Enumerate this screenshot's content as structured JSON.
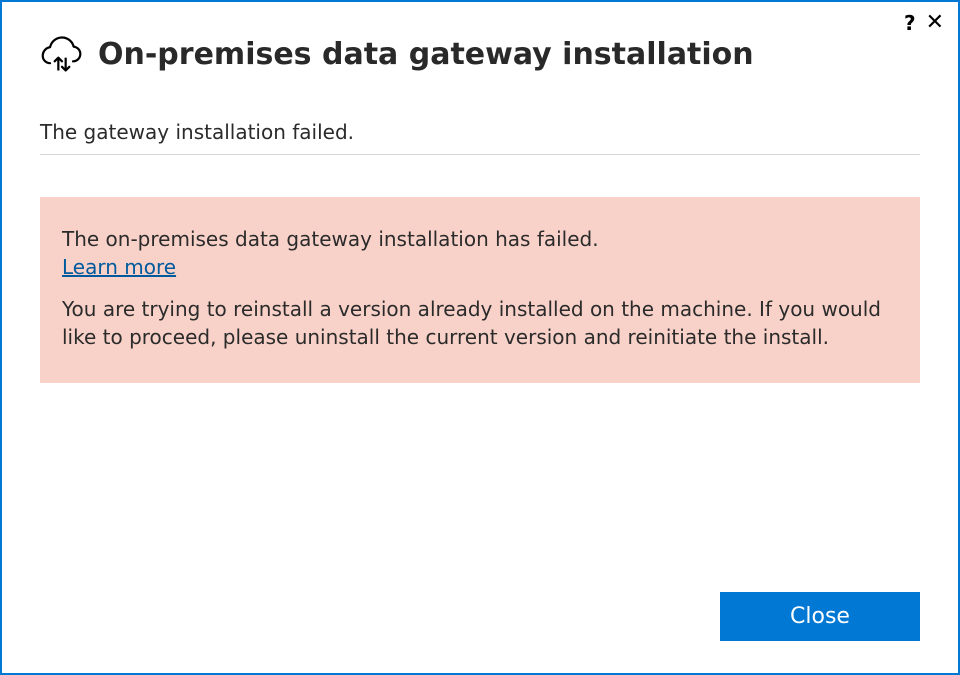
{
  "header": {
    "title": "On-premises data gateway installation"
  },
  "status": {
    "text": "The gateway installation failed."
  },
  "error": {
    "title": "The on-premises data gateway installation has failed.",
    "learn_more_label": "Learn more",
    "detail": "You are trying to reinstall a version already installed on the machine. If you would like to proceed, please uninstall the current version and reinitiate the install."
  },
  "footer": {
    "close_label": "Close"
  },
  "titlebar": {
    "help_label": "?",
    "close_label": "✕"
  }
}
